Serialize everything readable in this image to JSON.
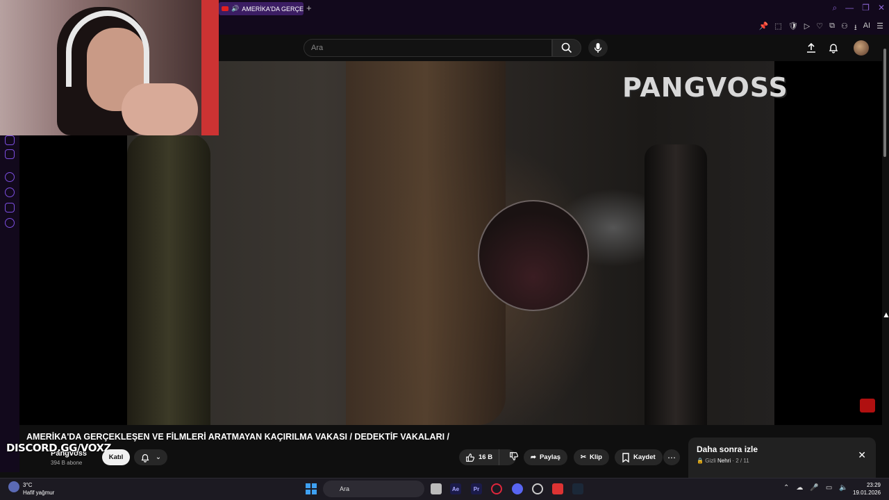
{
  "browser": {
    "tab_title": "AMERİKA'DA GERÇEK…",
    "new_tab": "+",
    "addr_icons": [
      "📌",
      "⬚",
      "🛡",
      "▷",
      "♡",
      "⧉",
      "⚇",
      "⭳",
      "AI",
      "☰"
    ]
  },
  "youtube": {
    "search_placeholder": "Ara",
    "video": {
      "watermark": "PANGVOSS",
      "title": "AMERİKA'DA GERÇEKLEŞEN VE FİLMLERİ ARATMAYAN KAÇIRILMA VAKASI / DEDEKTİF VAKALARI /"
    },
    "channel": {
      "name": "Pangvoss",
      "subscribers": "394 B abone",
      "join_label": "Katıl"
    },
    "actions": {
      "likes": "16 B",
      "share": "Paylaş",
      "clip": "Klip",
      "save": "Kaydet",
      "more": "⋯"
    },
    "watch_later": {
      "title": "Daha sonra izle",
      "privacy": "Gizli",
      "owner": "Nehri",
      "position": "2 / 11"
    }
  },
  "overlay": {
    "discord_text": "DISCORD.GG/VOXZ"
  },
  "taskbar": {
    "temperature": "3°C",
    "weather": "Hafif yağmur",
    "search_placeholder": "Ara",
    "time": "23:29",
    "date": "19.01.2026"
  }
}
